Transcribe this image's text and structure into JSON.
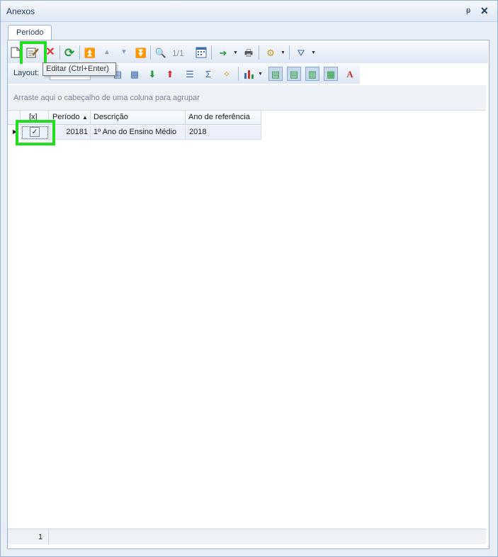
{
  "window": {
    "title": "Anexos",
    "pin_icon": "pin-icon",
    "close_icon": "close-icon"
  },
  "tab": {
    "label": "Período"
  },
  "toolbar": {
    "nav_counter": "1/1",
    "tooltip": "Editar (Ctrl+Enter)",
    "layout_label": "Layout:"
  },
  "group_hint": "Arraste aqui o cabeçalho de uma coluna para agrupar",
  "grid": {
    "columns": [
      "[x]",
      "Período",
      "Descrição",
      "Ano de referência"
    ],
    "sort_indicator": "▲",
    "rows": [
      {
        "checked": "✓",
        "periodo": "20181",
        "descricao": "1º Ano do Ensino Médio",
        "ano": "2018"
      }
    ]
  },
  "footer": {
    "count": "1"
  },
  "colors": {
    "highlight": "#22dd22",
    "border": "#9ab4d4",
    "selected_row": "#eaf1fb"
  }
}
